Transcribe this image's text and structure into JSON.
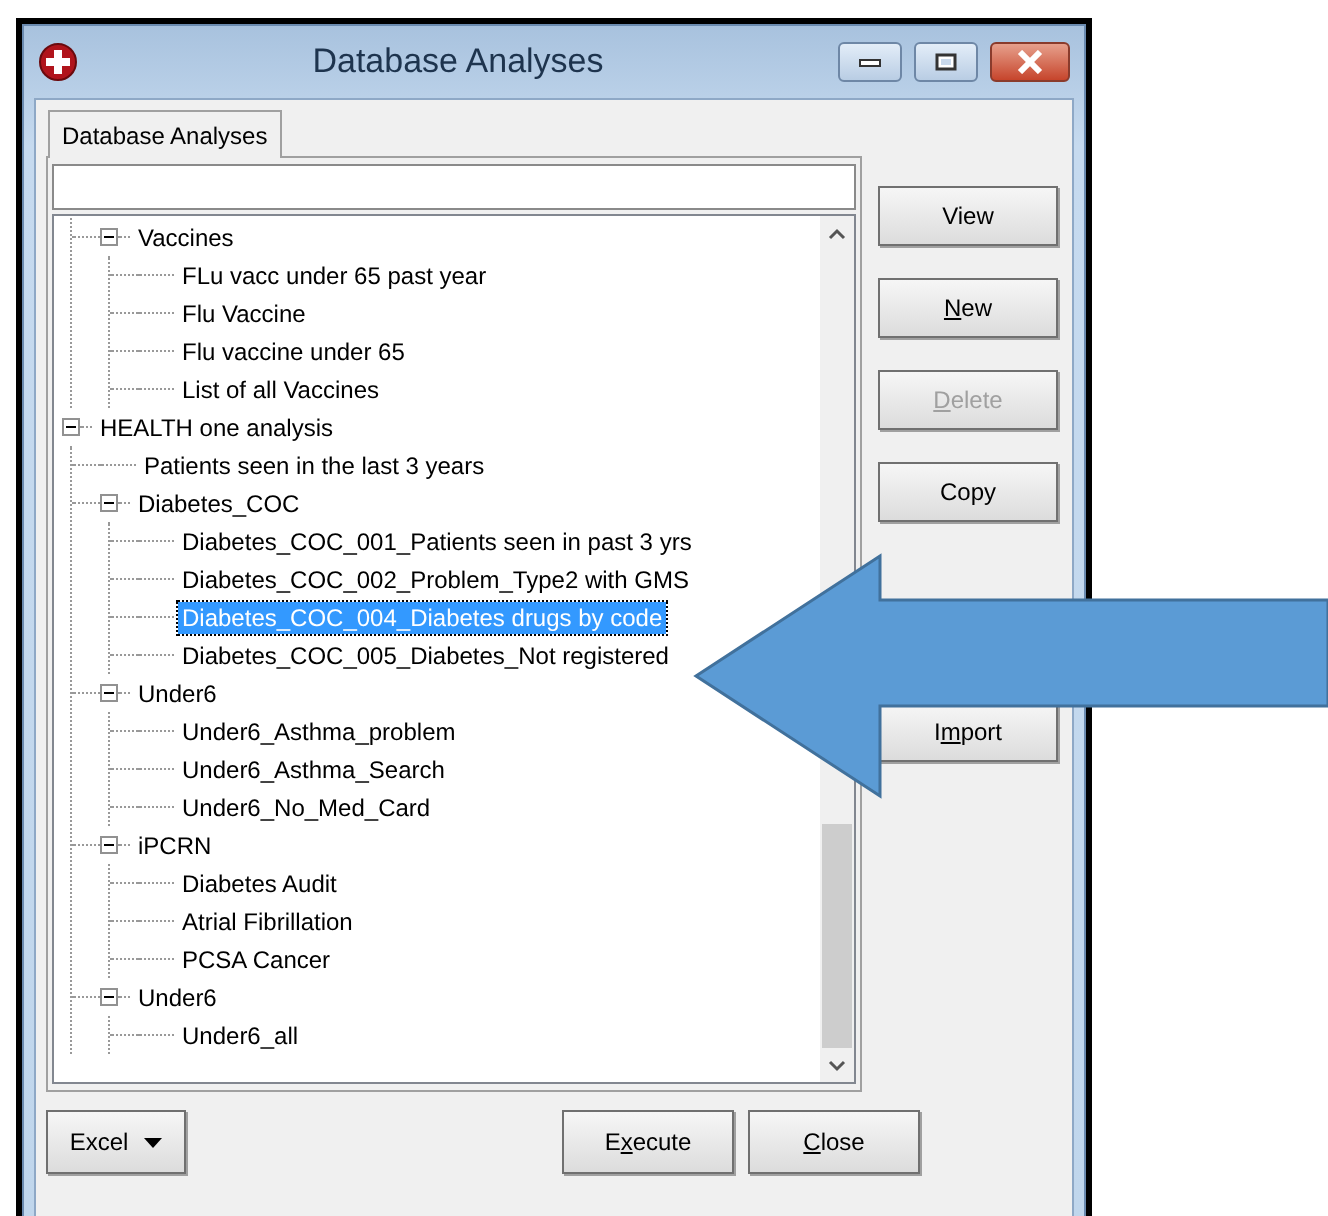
{
  "window": {
    "title": "Database Analyses"
  },
  "tabs": [
    {
      "label": "Database Analyses",
      "selected": true
    }
  ],
  "tree": {
    "items": [
      {
        "children": [
          {
            "label": "Vaccines",
            "expanded": true,
            "selected": false,
            "children": [
              {
                "label": "FLu vacc under 65 past year",
                "selected": false
              },
              {
                "label": "Flu Vaccine",
                "selected": false
              },
              {
                "label": "Flu vaccine under 65",
                "selected": false
              },
              {
                "label": "List of all Vaccines",
                "selected": false
              }
            ]
          }
        ]
      },
      {
        "label": "HEALTH one analysis",
        "expanded": true,
        "selected": false,
        "children": [
          {
            "label": "Patients seen in the last 3 years",
            "selected": false
          },
          {
            "label": "Diabetes_COC",
            "expanded": true,
            "selected": false,
            "children": [
              {
                "label": "Diabetes_COC_001_Patients seen in past 3 yrs",
                "selected": false
              },
              {
                "label": "Diabetes_COC_002_Problem_Type2 with GMS",
                "selected": false
              },
              {
                "label": "Diabetes_COC_004_Diabetes drugs by code",
                "selected": true
              },
              {
                "label": "Diabetes_COC_005_Diabetes_Not registered",
                "selected": false
              }
            ]
          },
          {
            "label": "Under6",
            "expanded": true,
            "selected": false,
            "children": [
              {
                "label": "Under6_Asthma_problem",
                "selected": false
              },
              {
                "label": "Under6_Asthma_Search",
                "selected": false
              },
              {
                "label": "Under6_No_Med_Card",
                "selected": false
              }
            ]
          },
          {
            "label": "iPCRN",
            "expanded": true,
            "selected": false,
            "children": [
              {
                "label": "Diabetes Audit",
                "selected": false
              },
              {
                "label": "Atrial Fibrillation",
                "selected": false
              },
              {
                "label": "PCSA Cancer",
                "selected": false
              }
            ]
          },
          {
            "label": "Under6",
            "expanded": true,
            "selected": false,
            "children": [
              {
                "label": "Under6_all",
                "selected": false
              }
            ]
          }
        ]
      }
    ]
  },
  "side_buttons": [
    {
      "pre": "View",
      "disabled": false
    },
    {
      "key": "N",
      "post": "ew",
      "disabled": false
    },
    {
      "key": "D",
      "post": "elete",
      "disabled": true
    },
    {
      "pre": "Copy",
      "disabled": false
    },
    {
      "pre": "I",
      "key": "m",
      "post": "port",
      "disabled": false
    }
  ],
  "bottom_buttons": [
    {
      "kind": "dropdown",
      "pre": "Excel"
    },
    {
      "kind": "push",
      "pre": "E",
      "key": "x",
      "post": "ecute"
    },
    {
      "kind": "push",
      "key": "C",
      "post": "lose"
    }
  ]
}
